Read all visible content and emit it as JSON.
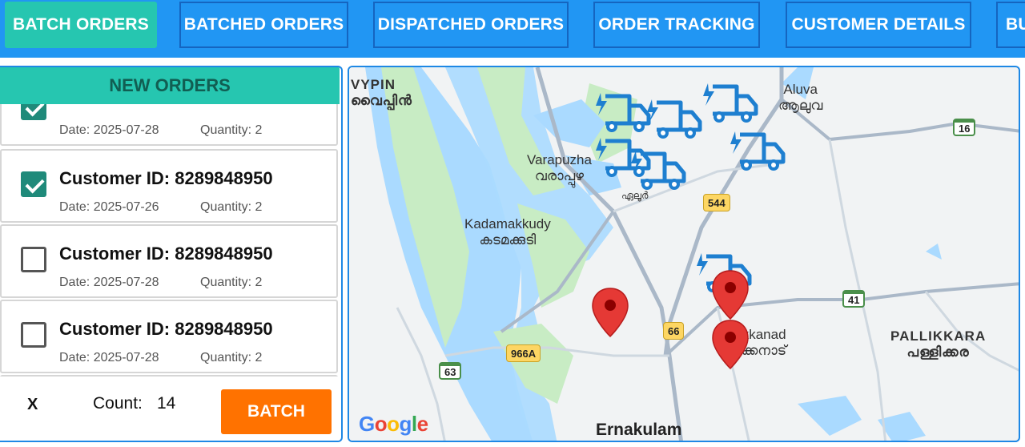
{
  "tabs": [
    {
      "label": "BATCH ORDERS",
      "active": true
    },
    {
      "label": "BATCHED ORDERS",
      "active": false
    },
    {
      "label": "DISPATCHED ORDERS",
      "active": false
    },
    {
      "label": "ORDER TRACKING",
      "active": false
    },
    {
      "label": "CUSTOMER DETAILS",
      "active": false
    },
    {
      "label": "BU",
      "active": false
    }
  ],
  "panel": {
    "title": "NEW ORDERS",
    "orders": [
      {
        "customer": "",
        "date": "Date: 2025-07-28",
        "quantity": "Quantity: 2",
        "checked": true
      },
      {
        "customer": "Customer ID: 8289848950",
        "date": "Date: 2025-07-26",
        "quantity": "Quantity: 2",
        "checked": true
      },
      {
        "customer": "Customer ID: 8289848950",
        "date": "Date: 2025-07-28",
        "quantity": "Quantity: 2",
        "checked": false
      },
      {
        "customer": "Customer ID: 8289848950",
        "date": "Date: 2025-07-28",
        "quantity": "Quantity: 2",
        "checked": false
      }
    ],
    "footer": {
      "clear_label": "X",
      "count_label": "Count:",
      "count_value": "14",
      "batch_label": "BATCH"
    }
  },
  "map": {
    "places": {
      "vypin_en": "VYPIN",
      "vypin_ml": "വൈപ്പിൻ",
      "aluva_en": "Aluva",
      "aluva_ml": "ആലുവ",
      "varapuzha_en": "Varapuzha",
      "varapuzha_ml": "വരാപ്പുഴ",
      "eloor_ml": "ഏലൂർ",
      "kadamakkudy_en": "Kadamakkudy",
      "kadamakkudy_ml": "കടമക്കുടി",
      "kakkanad_en": "kkanad",
      "kakkanad_ml": "ക്കനാട്",
      "pallikkara_en": "PALLIKKARA",
      "pallikkara_ml": "പള്ളിക്കര",
      "ernakulam_en": "Ernakulam"
    },
    "shields": {
      "nh16": "16",
      "nh544": "544",
      "nh41": "41",
      "nh66": "66",
      "nh966a": "966A",
      "nh63": "63"
    },
    "attribution": {
      "g1": "G",
      "o1": "o",
      "o2": "o",
      "g2": "g",
      "l": "l",
      "e": "e"
    },
    "colors": {
      "truck": "#1e7fd0",
      "pin": "#e53935",
      "water": "#aadaff",
      "land": "#f1f3f4",
      "green": "#c8ecc4"
    }
  }
}
